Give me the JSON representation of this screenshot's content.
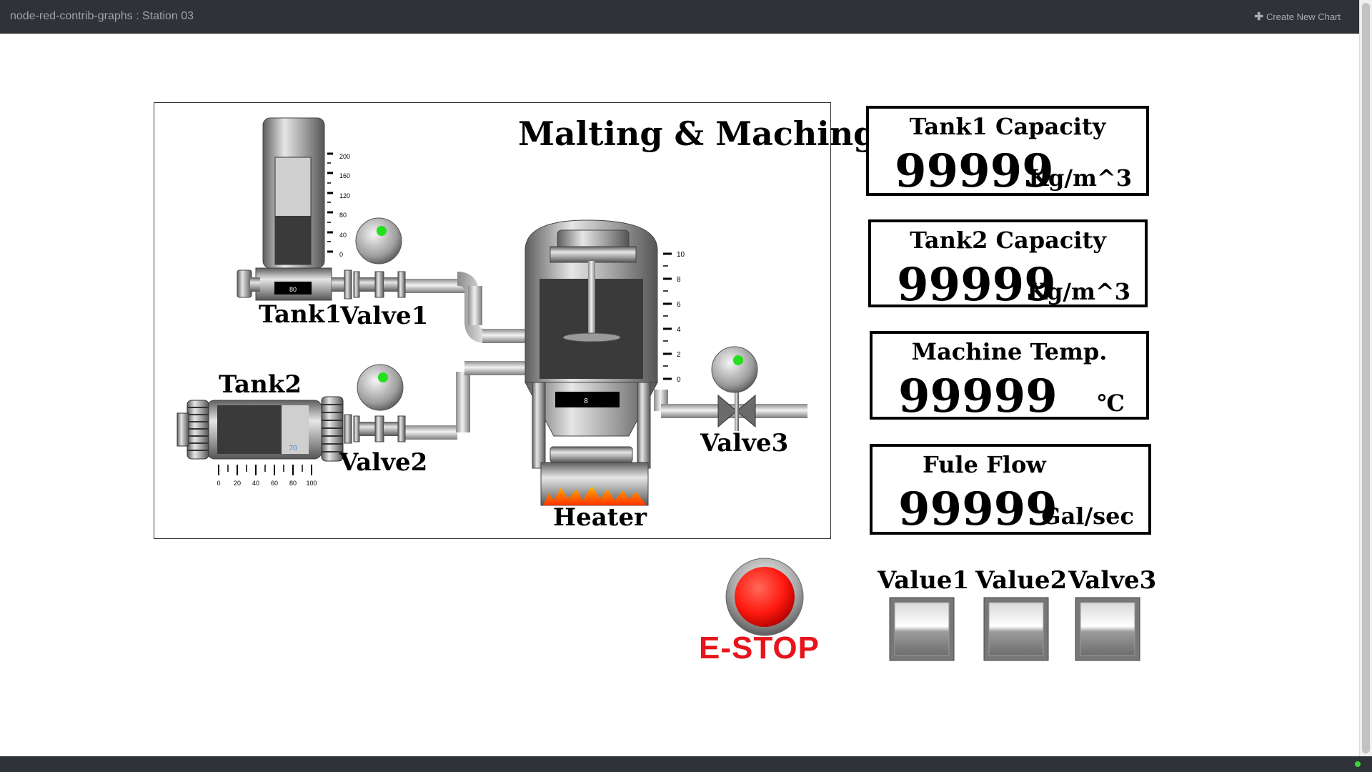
{
  "app": {
    "title": "node-red-contrib-graphs : Station 03",
    "create_label": "Create New Chart"
  },
  "panel": {
    "title": "Malting & Maching",
    "labels": {
      "tank1": "Tank1",
      "valve1": "Valve1",
      "tank2": "Tank2",
      "valve2": "Valve2",
      "valve3": "Valve3",
      "heater": "Heater"
    },
    "tank1_display": "80",
    "tank1_scale": [
      "200",
      "160",
      "120",
      "80",
      "40",
      "0"
    ],
    "tank2_display": "70",
    "tank2_scale": [
      "0",
      "20",
      "40",
      "60",
      "80",
      "100"
    ],
    "mixer_display": "8",
    "mixer_scale": [
      "10",
      "8",
      "6",
      "4",
      "2",
      "0"
    ]
  },
  "cards": [
    {
      "title": "Tank1 Capacity",
      "value": "99999",
      "unit": "Kg/m^3"
    },
    {
      "title": "Tank2 Capacity",
      "value": "99999",
      "unit": "Kg/m^3"
    },
    {
      "title": "Machine Temp.",
      "value": "99999",
      "unit": "℃"
    },
    {
      "title": "Fule Flow",
      "value": "99999",
      "unit": "Gal/sec"
    }
  ],
  "estop_label": "E-STOP",
  "switches": [
    {
      "label": "Value1"
    },
    {
      "label": "Value2"
    },
    {
      "label": "Valve3"
    }
  ],
  "colors": {
    "topbar": "#2f3236",
    "estop_red": "#e8141c",
    "indicator_green": "#22e01c",
    "flame": "#ff4a00"
  }
}
